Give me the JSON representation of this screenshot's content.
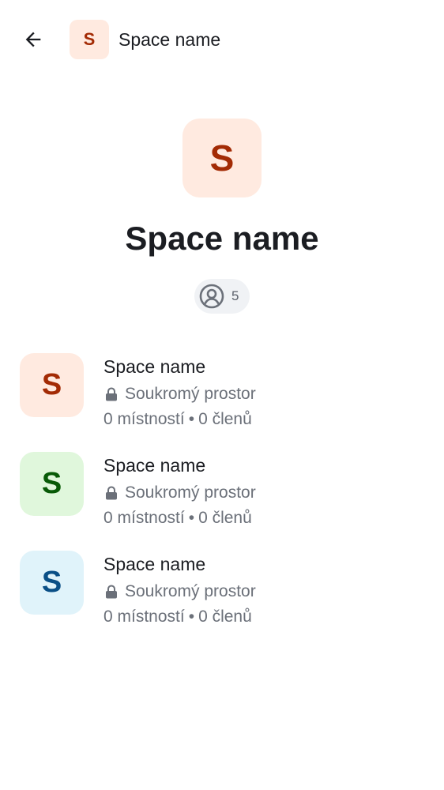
{
  "header": {
    "back_icon": "arrow-left-icon",
    "avatar_letter": "S",
    "avatar_bg": "#ffeae0",
    "avatar_fg": "#a32b05",
    "title": "Space name"
  },
  "hero": {
    "avatar_letter": "S",
    "avatar_bg": "#ffeae0",
    "avatar_fg": "#a32b05",
    "title": "Space name",
    "member_icon": "user-profile-icon",
    "member_count": "5"
  },
  "spaces": [
    {
      "letter": "S",
      "bg": "#ffeae0",
      "fg": "#a32b05",
      "name": "Space name",
      "privacy_icon": "lock-icon",
      "privacy": "Soukromý prostor",
      "rooms": "0 místností",
      "separator": "•",
      "members": "0 členů"
    },
    {
      "letter": "S",
      "bg": "#e0f7dc",
      "fg": "#085a07",
      "name": "Space name",
      "privacy_icon": "lock-icon",
      "privacy": "Soukromý prostor",
      "rooms": "0 místností",
      "separator": "•",
      "members": "0 členů"
    },
    {
      "letter": "S",
      "bg": "#e0f3fa",
      "fg": "#0a4f86",
      "name": "Space name",
      "privacy_icon": "lock-icon",
      "privacy": "Soukromý prostor",
      "rooms": "0 místností",
      "separator": "•",
      "members": "0 členů"
    }
  ]
}
